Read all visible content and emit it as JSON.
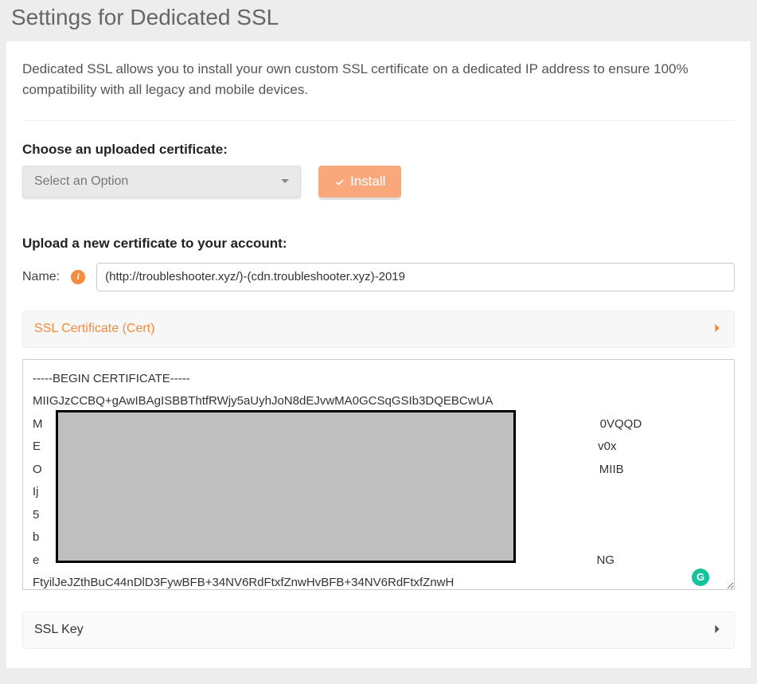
{
  "page_title": "Settings for Dedicated SSL",
  "intro_text": "Dedicated SSL allows you to install your own custom SSL certificate on a dedicated IP address to ensure 100% compatibility with all legacy and mobile devices.",
  "choose": {
    "label": "Choose an uploaded certificate:",
    "select_placeholder": "Select an Option",
    "install_label": "Install"
  },
  "upload": {
    "heading": "Upload a new certificate to your account:",
    "name_label": "Name:",
    "name_value": "(http://troubleshooter.xyz/)-(cdn.troubleshooter.xyz)-2019"
  },
  "accordion": {
    "cert_header": "SSL Certificate (Cert)",
    "key_header": "SSL Key"
  },
  "cert_text": "-----BEGIN CERTIFICATE-----\nMIIGJzCCBQ+gAwIBAgISBBThtfRWjy5aUyhJoN8dEJvwMA0GCSqGSIb3DQEBCwUA\nM                                                                                                                                                                        0VQQD\nE                                                                                                                                                                        v0x\nO                                                                                                                                                                        MIIB\nIj\n5\nb\ne                                                                                                                                                                        NG\nFtyilJeJZthBuC44nDlD3FywBFB+34NV6RdFtxfZnwHvBFB+34NV6RdFtxfZnwH",
  "grammarly_letter": "G"
}
